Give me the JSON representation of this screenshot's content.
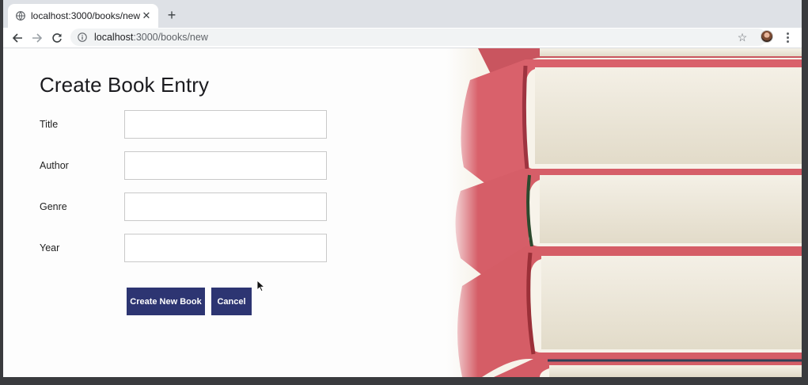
{
  "browser": {
    "tab_title": "localhost:3000/books/new",
    "url_host": "localhost",
    "url_rest": ":3000/books/new"
  },
  "page": {
    "title": "Create Book Entry",
    "fields": [
      {
        "label": "Title",
        "value": "",
        "placeholder": ""
      },
      {
        "label": "Author",
        "value": "",
        "placeholder": ""
      },
      {
        "label": "Genre",
        "value": "",
        "placeholder": ""
      },
      {
        "label": "Year",
        "value": "",
        "placeholder": ""
      }
    ],
    "buttons": {
      "create": "Create New Book",
      "cancel": "Cancel"
    }
  },
  "colors": {
    "button_bg": "#2d3572",
    "book_cover_red": "#d9606a",
    "book_pages": "#ece6d7"
  },
  "icons": [
    "globe-icon",
    "close-icon",
    "plus-icon",
    "back-arrow-icon",
    "forward-arrow-icon",
    "reload-icon",
    "info-icon",
    "star-icon",
    "avatar",
    "kebab-menu-icon",
    "mouse-cursor-icon"
  ]
}
